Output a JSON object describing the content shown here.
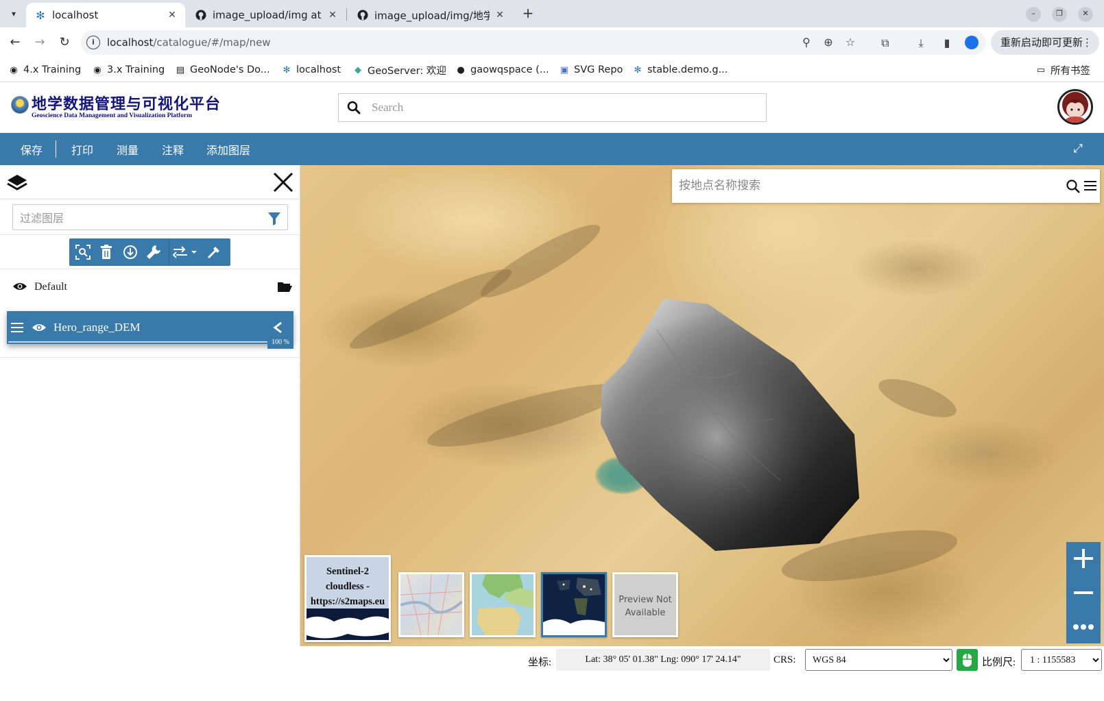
{
  "browser": {
    "tabs": [
      {
        "title": "localhost",
        "active": true,
        "icon": "geonode-icon"
      },
      {
        "title": "image_upload/img at m",
        "active": false,
        "icon": "github-icon"
      },
      {
        "title": "image_upload/img/地学",
        "active": false,
        "icon": "github-icon"
      }
    ],
    "new_tab_symbol": "+",
    "url_host": "localhost",
    "url_path": "/catalogue/#/map/new",
    "update_button": "重新启动即可更新",
    "bookmarks": [
      {
        "label": "4.x Training",
        "icon": "globe-icon"
      },
      {
        "label": "3.x Training",
        "icon": "globe-icon"
      },
      {
        "label": "GeoNode's Do...",
        "icon": "document-icon"
      },
      {
        "label": "localhost",
        "icon": "geonode-icon"
      },
      {
        "label": "GeoServer: 欢迎",
        "icon": "geoserver-icon"
      },
      {
        "label": "gaowqspace (...",
        "icon": "github-icon"
      },
      {
        "label": "SVG Repo",
        "icon": "svgrepo-icon"
      },
      {
        "label": "stable.demo.g...",
        "icon": "geonode-icon"
      }
    ],
    "all_bookmarks": "所有书签"
  },
  "app": {
    "logo_cn": "地学数据管理与可视化平台",
    "logo_en": "Geoscience Data Management and Visualization Platform",
    "search_placeholder": "Search"
  },
  "toolbar": {
    "items": [
      "保存",
      "打印",
      "测量",
      "注释",
      "添加图层"
    ]
  },
  "layers_panel": {
    "filter_placeholder": "过滤图层",
    "group_name": "Default",
    "layer_name": "Hero_range_DEM",
    "layer_opacity": "100 %",
    "opacity_value": 1.0
  },
  "map": {
    "place_search_placeholder": "按地点名称搜索",
    "basemaps": [
      {
        "label": "Sentinel-2 cloudless - https://s2maps.eu",
        "selected": false
      },
      {
        "label": "",
        "selected": false
      },
      {
        "label": "",
        "selected": false
      },
      {
        "label": "",
        "selected": true
      },
      {
        "label": "Preview Not Available",
        "selected": false
      }
    ]
  },
  "footer": {
    "coord_label": "坐标:",
    "coords": "Lat: 38° 05' 01.38\" Lng: 090° 17' 24.14\"",
    "crs_label": "CRS:",
    "crs_value": "WGS 84",
    "scale_label": "比例尺:",
    "scale_value": "1 : 1155583"
  },
  "colors": {
    "accent": "#397aab",
    "mouse_toggle": "#28a745",
    "logo_text": "#13147a"
  }
}
